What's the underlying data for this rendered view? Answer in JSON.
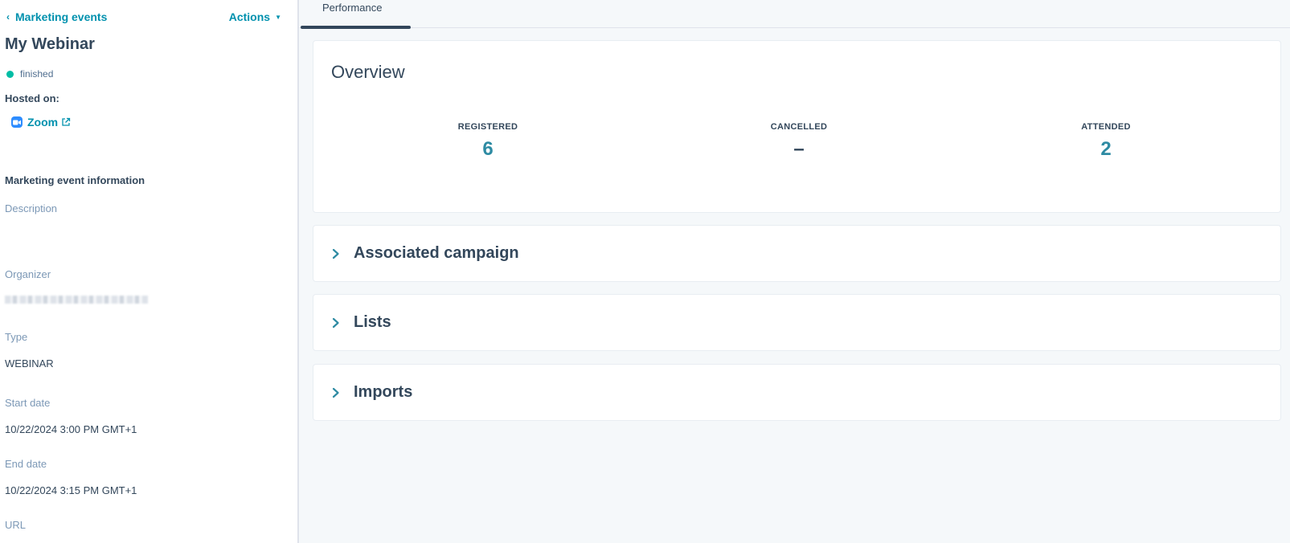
{
  "sidebar": {
    "back_label": "Marketing events",
    "actions_label": "Actions",
    "event_title": "My Webinar",
    "status": "finished",
    "hosted_label": "Hosted on:",
    "hosted_platform": "Zoom",
    "section_title": "Marketing event information",
    "fields": {
      "description_label": "Description",
      "organizer_label": "Organizer",
      "type_label": "Type",
      "type_value": "WEBINAR",
      "start_label": "Start date",
      "start_value": "10/22/2024 3:00 PM GMT+1",
      "end_label": "End date",
      "end_value": "10/22/2024 3:15 PM GMT+1",
      "url_label": "URL"
    }
  },
  "main": {
    "active_tab": "Performance",
    "overview": {
      "title": "Overview",
      "metrics": {
        "registered_label": "REGISTERED",
        "registered_value": "6",
        "cancelled_label": "CANCELLED",
        "cancelled_value": "–",
        "attended_label": "ATTENDED",
        "attended_value": "2"
      }
    },
    "sections": {
      "associated_campaign": "Associated campaign",
      "lists": "Lists",
      "imports": "Imports"
    }
  },
  "colors": {
    "accent_link": "#0091ae",
    "metric_value": "#2e8ba3",
    "status_dot": "#00bda5",
    "text": "#33475b",
    "muted_label": "#7c98b6",
    "zoom_blue": "#2d8cff"
  }
}
